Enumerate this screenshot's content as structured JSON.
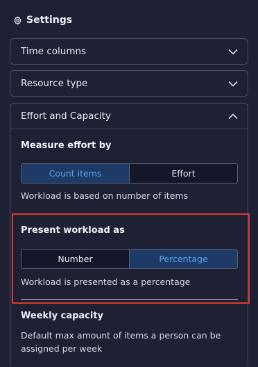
{
  "header": {
    "title": "Settings",
    "icon": "gear-icon"
  },
  "accordions": {
    "time_columns": {
      "label": "Time columns",
      "state": "collapsed"
    },
    "resource_type": {
      "label": "Resource type",
      "state": "collapsed"
    },
    "effort_capacity": {
      "label": "Effort and Capacity",
      "state": "expanded"
    }
  },
  "measure_effort": {
    "title": "Measure effort by",
    "options": [
      "Count items",
      "Effort"
    ],
    "selected": "Count items",
    "description": "Workload is based on number of items"
  },
  "present_workload": {
    "title": "Present workload as",
    "options": [
      "Number",
      "Percentage"
    ],
    "selected": "Percentage",
    "description": "Workload is presented as a percentage"
  },
  "weekly_capacity": {
    "title": "Weekly capacity",
    "description_line1": "Default max amount of items a person can be",
    "description_line2": "assigned per week"
  },
  "colors": {
    "background": "#1d2133",
    "active_segment_bg": "#1e3a66",
    "active_segment_text": "#5aa2f0",
    "highlight": "#e0392e",
    "border": "#4a5068"
  }
}
